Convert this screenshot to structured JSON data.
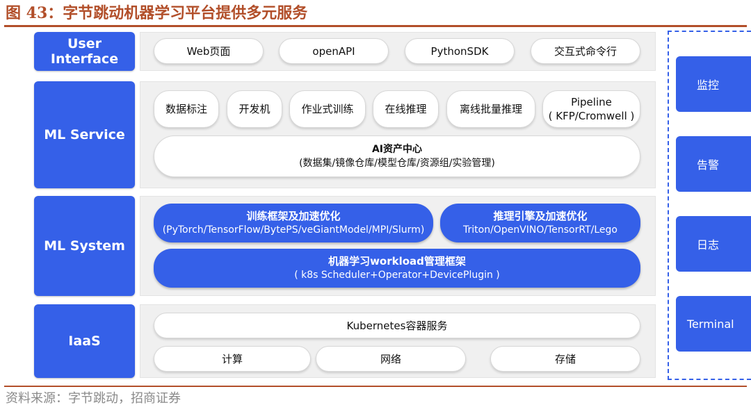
{
  "title": "图 43：字节跳动机器学习平台提供多元服务",
  "source": "资料来源：字节跳动，招商证券",
  "layers": {
    "user_interface": {
      "label": "User Interface",
      "items": [
        "Web页面",
        "openAPI",
        "PythonSDK",
        "交互式命令行"
      ]
    },
    "ml_service": {
      "label": "ML Service",
      "items": [
        "数据标注",
        "开发机",
        "作业式训练",
        "在线推理",
        "离线批量推理"
      ],
      "pipeline": {
        "line1": "Pipeline",
        "line2": "( KFP/Cromwell )"
      },
      "asset_center": {
        "title": "AI资产中心",
        "subtitle": "(数据集/镜像仓库/模型仓库/资源组/实验管理)"
      }
    },
    "ml_system": {
      "label": "ML System",
      "training": {
        "title": "训练框架及加速优化",
        "subtitle": "(PyTorch/TensorFlow/BytePS/veGiantModel/MPI/Slurm)"
      },
      "inference": {
        "title": "推理引擎及加速优化",
        "subtitle": "Triton/OpenVINO/TensorRT/Lego"
      },
      "workload": {
        "title": "机器学习workload管理框架",
        "subtitle": "( k8s Scheduler+Operator+DevicePlugin )"
      }
    },
    "iaas": {
      "label": "IaaS",
      "kubernetes": "Kubernetes容器服务",
      "items": [
        "计算",
        "网络",
        "存储"
      ]
    }
  },
  "side": {
    "items": [
      "监控",
      "告警",
      "日志",
      "Terminal"
    ]
  },
  "colors": {
    "accent_blue": "#3560e8",
    "title_red": "#b24f2a",
    "panel_grey": "#f0f0f0"
  }
}
